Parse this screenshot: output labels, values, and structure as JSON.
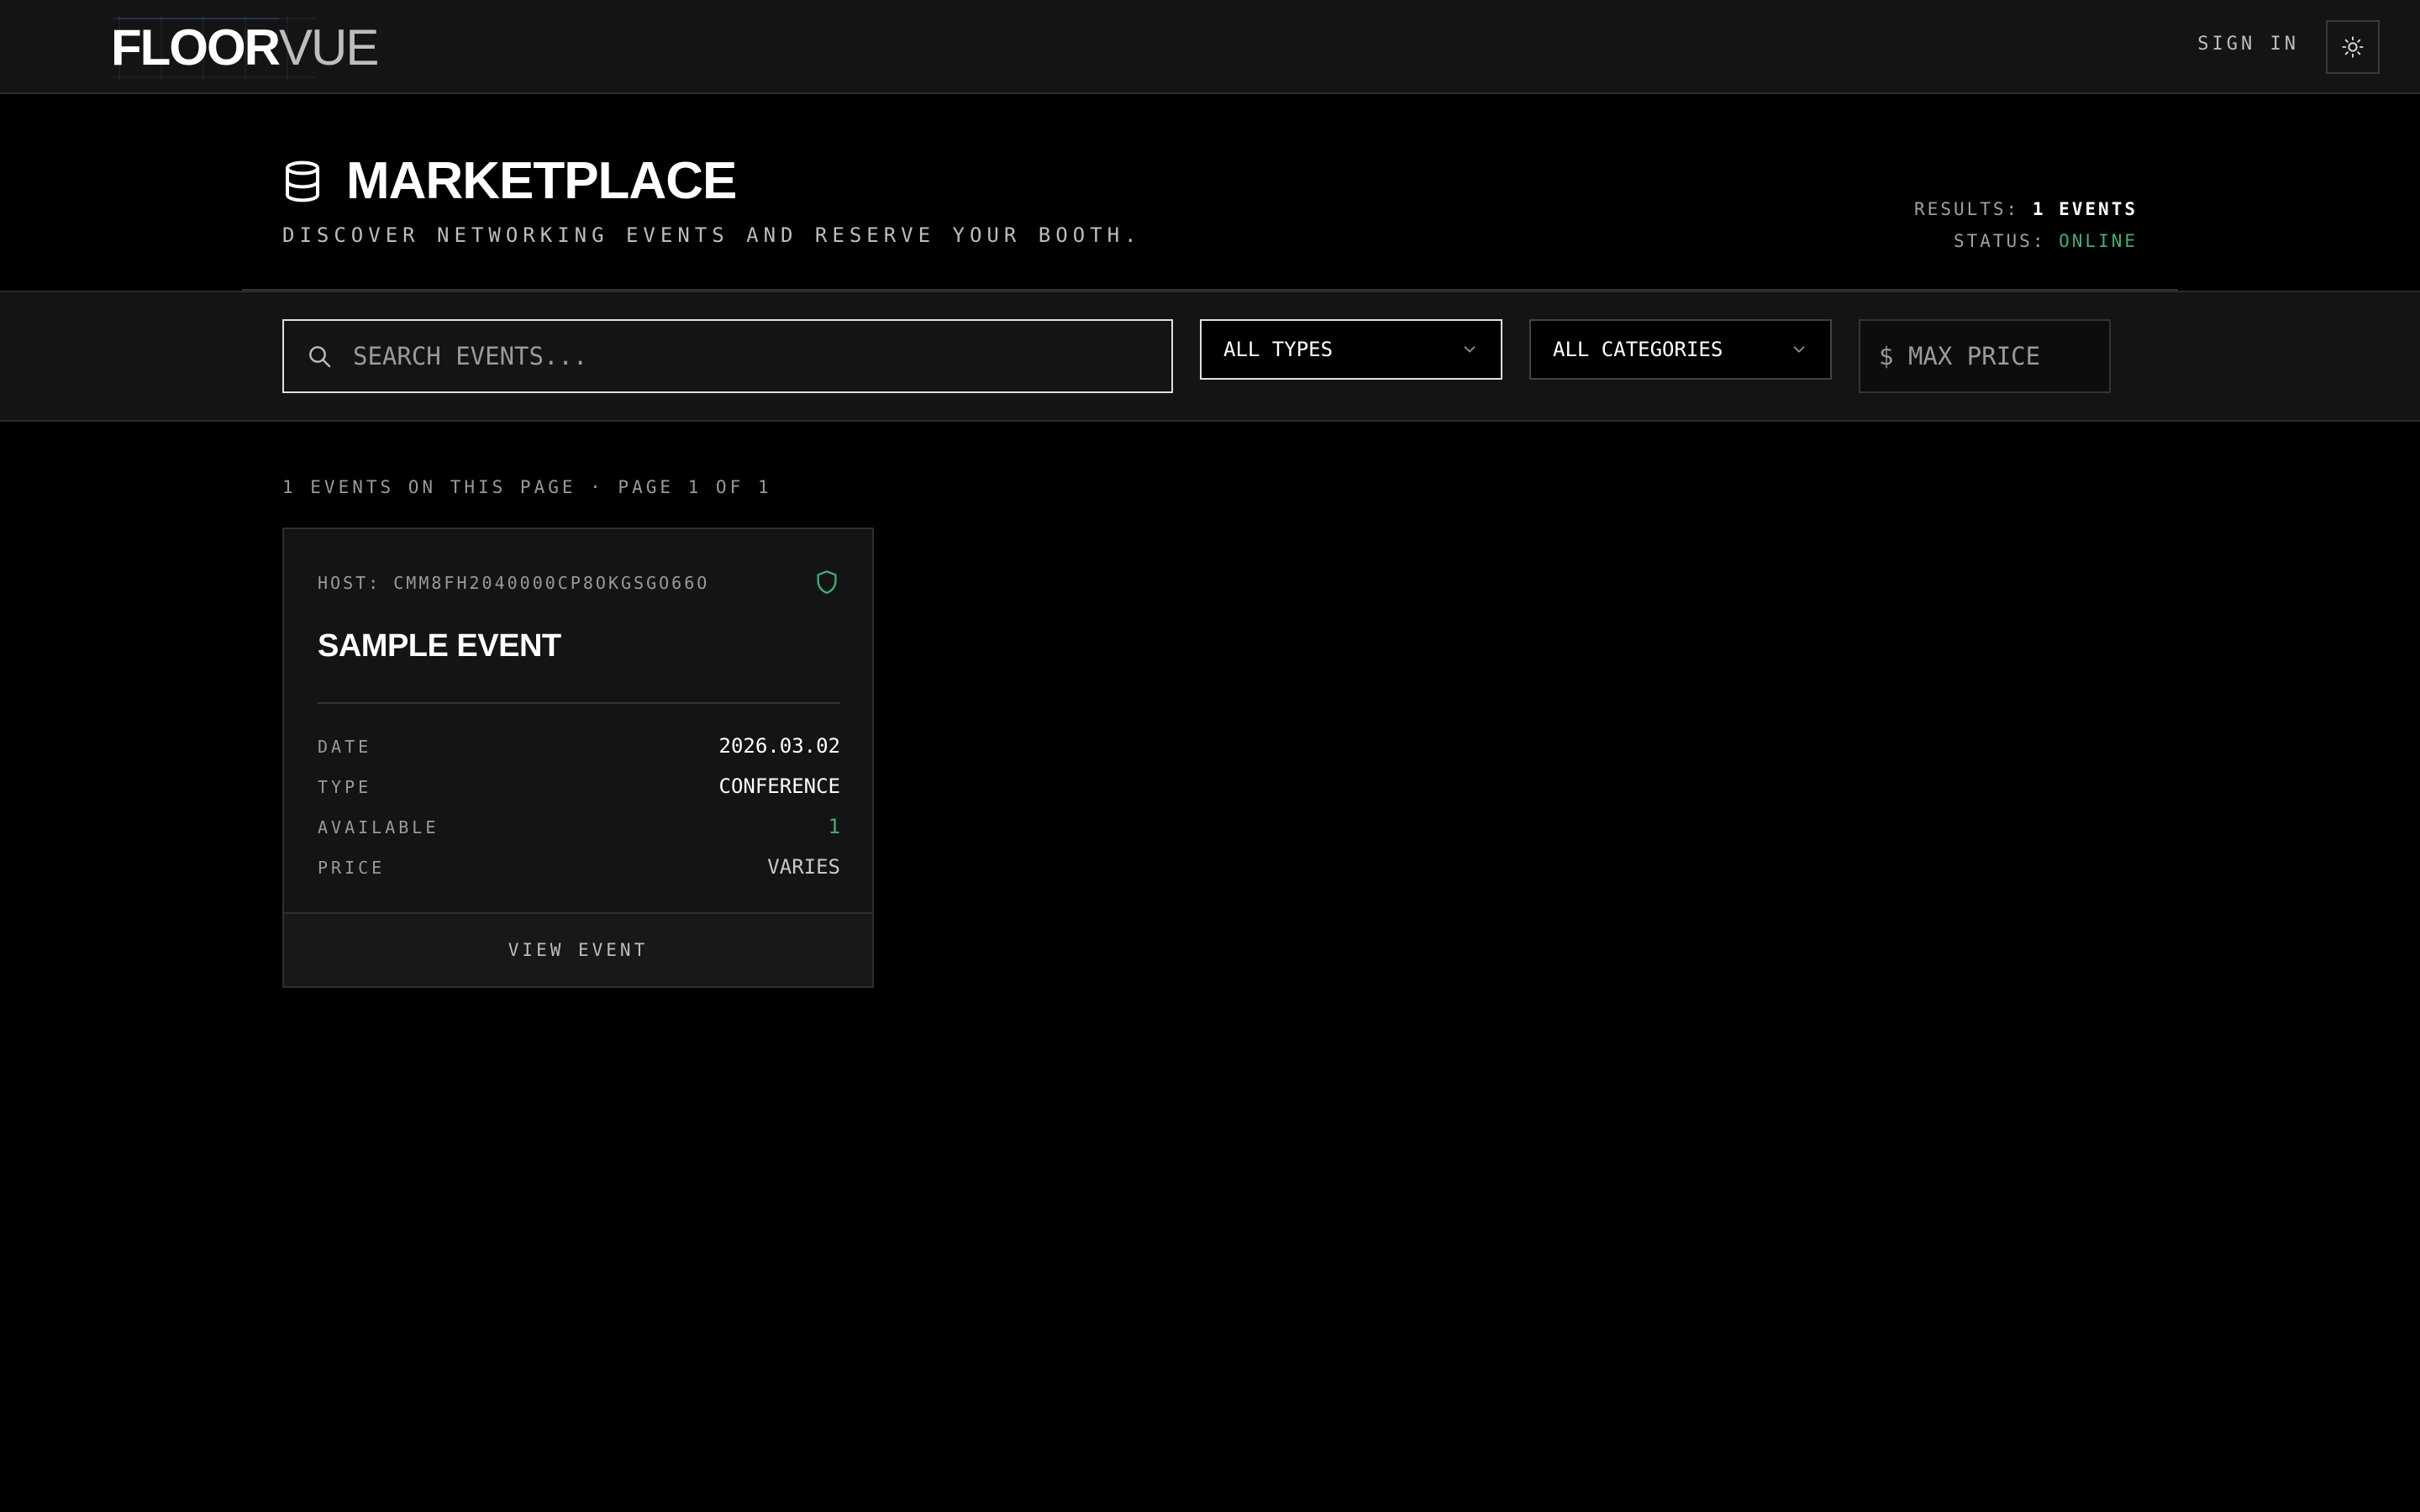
{
  "header": {
    "logo_bold": "FLOOR",
    "logo_light": "VUE",
    "signin_label": "SIGN IN",
    "theme_icon": "sun-icon"
  },
  "hero": {
    "icon": "database-icon",
    "title": "MARKETPLACE",
    "subtitle": "DISCOVER NETWORKING EVENTS AND RESERVE YOUR BOOTH.",
    "results_label": "RESULTS:",
    "results_value": "1 EVENTS",
    "status_label": "STATUS:",
    "status_value": "ONLINE"
  },
  "filters": {
    "search_placeholder": "SEARCH EVENTS...",
    "search_value": "",
    "type_selected": "ALL TYPES",
    "category_selected": "ALL CATEGORIES",
    "price_prefix": "$",
    "price_placeholder": "MAX PRICE"
  },
  "listing": {
    "page_info": "1 EVENTS ON THIS PAGE · PAGE 1 OF 1",
    "events": [
      {
        "host": "HOST: CMM8FH2040000CP8OKGSGO66O",
        "title": "SAMPLE EVENT",
        "date_label": "DATE",
        "date_value": "2026.03.02",
        "type_label": "TYPE",
        "type_value": "CONFERENCE",
        "available_label": "AVAILABLE",
        "available_value": "1",
        "price_label": "PRICE",
        "price_value": "VARIES",
        "action_label": "VIEW EVENT"
      }
    ]
  },
  "colors": {
    "background": "#000000",
    "panel": "#141414",
    "accent_green": "#3fae7a",
    "muted_text": "#9a9a9a"
  }
}
